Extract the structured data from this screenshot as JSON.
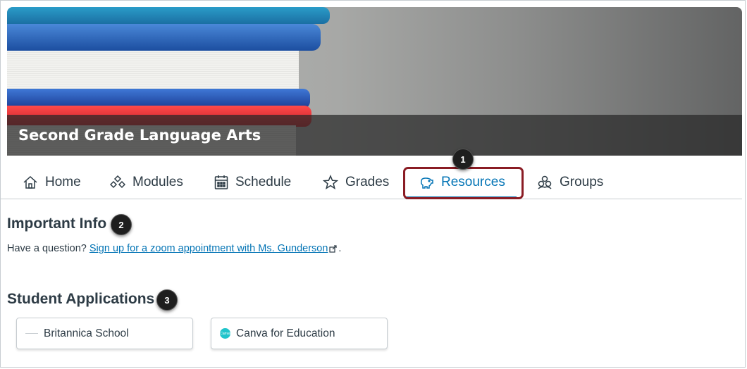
{
  "course": {
    "title": "Second Grade Language Arts"
  },
  "tabs": [
    {
      "label": "Home",
      "icon": "home-icon"
    },
    {
      "label": "Modules",
      "icon": "modules-icon"
    },
    {
      "label": "Schedule",
      "icon": "calendar-icon"
    },
    {
      "label": "Grades",
      "icon": "star-icon"
    },
    {
      "label": "Resources",
      "icon": "piggy-bank-icon",
      "active": true
    },
    {
      "label": "Groups",
      "icon": "groups-icon"
    }
  ],
  "callouts": [
    "1",
    "2",
    "3"
  ],
  "important_info": {
    "heading": "Important Info",
    "prefix": "Have a question?",
    "link_text": "Sign up for a zoom appointment with Ms. Gunderson",
    "suffix": "."
  },
  "student_apps": {
    "heading": "Student Applications",
    "apps": [
      {
        "name": "Britannica School"
      },
      {
        "name": "Canva for Education",
        "logo_text": "Canva"
      }
    ]
  },
  "colors": {
    "accent": "#0374b5",
    "text": "#2d3b45",
    "highlight": "#8a1c24",
    "border": "#c7cdd1"
  }
}
